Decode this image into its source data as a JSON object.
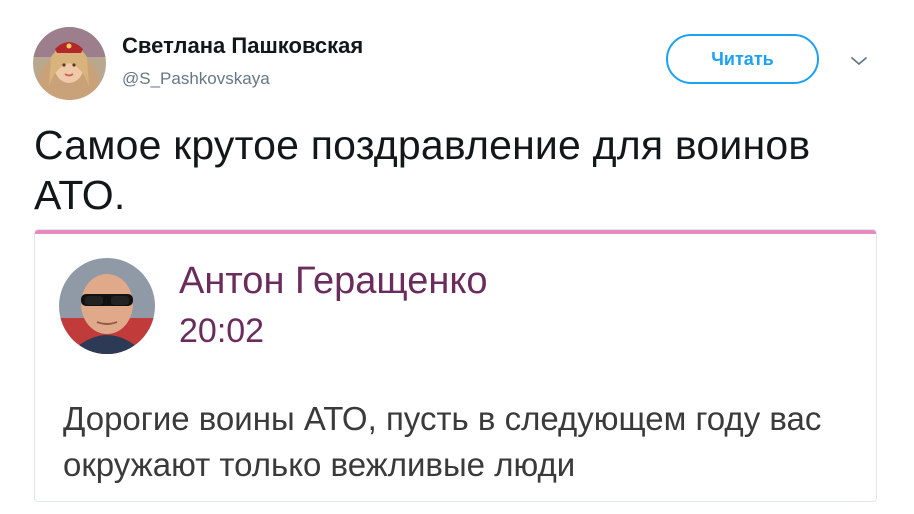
{
  "tweet": {
    "author_name": "Светлана Пашковская",
    "author_handle": "@S_Pashkovskaya",
    "follow_label": "Читать",
    "text": "Самое крутое поздравление для воинов АТО."
  },
  "embedded_post": {
    "author": "Антон Геращенко",
    "time": "20:02",
    "text": "Дорогие воины АТО, пусть в следующем году вас окружают только вежливые люди"
  },
  "icons": {
    "menu": "chevron-down-icon"
  },
  "colors": {
    "accent": "#1da1f2",
    "post_name": "#6a2c5c",
    "card_topbar": "#e58bc0",
    "handle": "#657786"
  }
}
